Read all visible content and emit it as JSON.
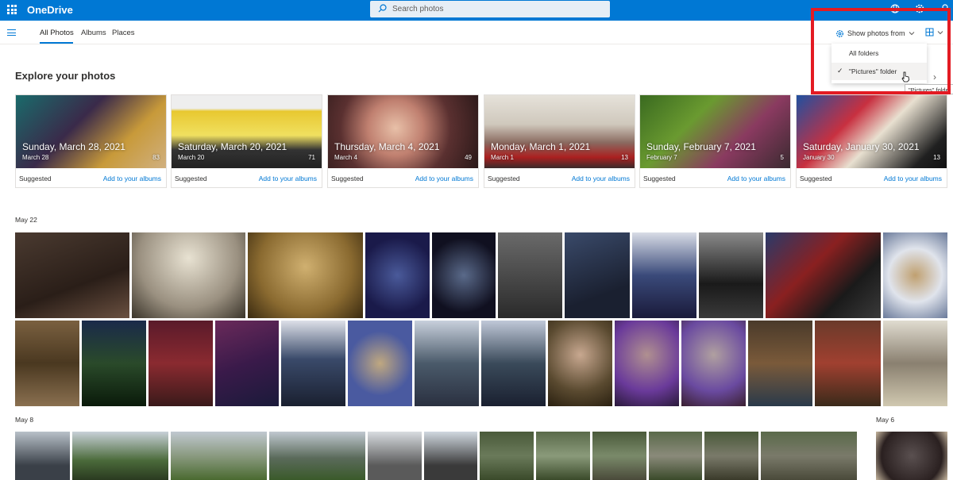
{
  "app": {
    "name": "OneDrive"
  },
  "search": {
    "placeholder": "Search photos"
  },
  "nav": {
    "tabs": [
      "All Photos",
      "Albums",
      "Places"
    ],
    "active": "All Photos"
  },
  "filter": {
    "button_label": "Show photos from",
    "options": [
      "All folders",
      "\"Pictures\" folder"
    ],
    "selected": "\"Pictures\" folder",
    "tooltip": "\"Pictures\" folder"
  },
  "explore": {
    "heading": "Explore your photos",
    "suggested_label": "Suggested",
    "add_label": "Add to your albums",
    "cards": [
      {
        "date": "Sunday, March 28, 2021",
        "sub": "March 28",
        "count": "83"
      },
      {
        "date": "Saturday, March 20, 2021",
        "sub": "March 20",
        "count": "71"
      },
      {
        "date": "Thursday, March 4, 2021",
        "sub": "March 4",
        "count": "49"
      },
      {
        "date": "Monday, March 1, 2021",
        "sub": "March 1",
        "count": "13"
      },
      {
        "date": "Sunday, February 7, 2021",
        "sub": "February 7",
        "count": "5"
      },
      {
        "date": "Saturday, January 30, 2021",
        "sub": "January 30",
        "count": "13"
      }
    ]
  },
  "groups": [
    "May 22",
    "May 8",
    "May 6"
  ],
  "colors": {
    "brand": "#0078d4",
    "highlight": "#e31b23"
  }
}
